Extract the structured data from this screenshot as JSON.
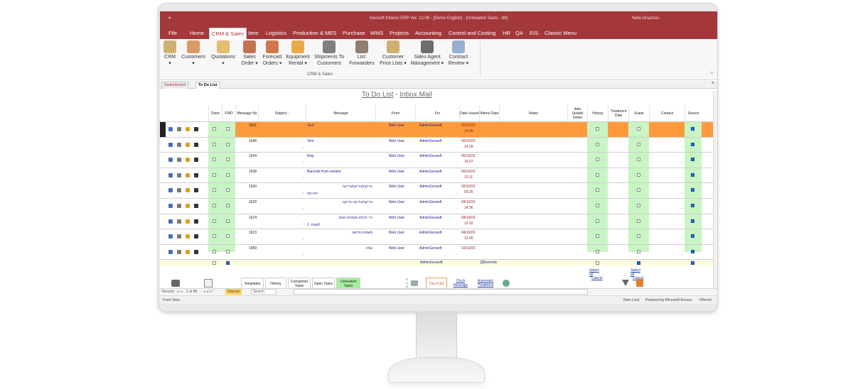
{
  "window": {
    "qat": "▾",
    "title": "Geosoft Kitaron ERP Ver. 12.06 - [Demo English] - [Untreated Tasks - 89]",
    "user": "Neta Griaznov"
  },
  "tabs": [
    "File",
    "Home",
    "CRM & Sales",
    "Item",
    "Logistics",
    "Production & MES",
    "Purchase",
    "WMS",
    "Projects",
    "Accounting",
    "Control and Costing",
    "HR",
    "QA",
    "EIS",
    "Classic Menu"
  ],
  "ribbon": {
    "buttons": [
      {
        "label1": "CRM",
        "label2": "▾",
        "color": "#c9a35a"
      },
      {
        "label1": "Customers",
        "label2": "▾",
        "color": "#d38b4a"
      },
      {
        "label1": "Quotations",
        "label2": "▾",
        "color": "#e0b25a"
      },
      {
        "label1": "Sales",
        "label2": "Order ▾",
        "color": "#b85a3a"
      },
      {
        "label1": "Forecast",
        "label2": "Orders ▾",
        "color": "#c8612f"
      },
      {
        "label1": "Equipment",
        "label2": "Rental ▾",
        "color": "#e89b2a"
      },
      {
        "label1": "Shipments To",
        "label2": "Customers",
        "color": "#6a6a6a"
      },
      {
        "label1": "List:",
        "label2": "Forwarders",
        "color": "#7b6a5a"
      },
      {
        "label1": "Customer",
        "label2": "Price Lists ▾",
        "color": "#c9a35a"
      },
      {
        "label1": "Sales Agent",
        "label2": "Management ▾",
        "color": "#555555"
      },
      {
        "label1": "Contract",
        "label2": "Review ▾",
        "color": "#8aa2c8"
      }
    ],
    "group_label": "CRM & Sales",
    "collapse": "^"
  },
  "doc_tabs": [
    {
      "label": "Switchboard"
    },
    {
      "label": "To Do List"
    }
  ],
  "doc_close": "×",
  "caption": {
    "part1": "To Do List",
    "sep": " - ",
    "part2": "Inbox Mail"
  },
  "columns": [
    "Done",
    "FWD",
    "Message No",
    "Subject...",
    "Message",
    "From",
    "For",
    "Date Issued",
    "Memo Date",
    "Notes",
    "date Update Notes",
    "History",
    "Treatment Date",
    "Erase",
    "Contact",
    "Source"
  ],
  "rows": [
    {
      "no": "1651",
      "message": "Test",
      "from": "Web User",
      "for": "AdminGeosoft",
      "date": "05/10/23",
      "time": "14:45",
      "selected": true,
      "source": true
    },
    {
      "no": "1648",
      "message": "Tom",
      "from": "Web User",
      "for": "AdminGeosoft",
      "date": "05/10/23",
      "time": "14:29",
      "selected": false,
      "source": true
    },
    {
      "no": "1644",
      "message": "Rog",
      "from": "Web User",
      "for": "AdminGeosoft",
      "date": "05/10/23",
      "time": "14:27",
      "selected": false,
      "source": true
    },
    {
      "no": "1638",
      "message": "Barcode from monitor",
      "from": "Web User",
      "for": "AdminGeosoft",
      "date": "05/10/23",
      "time": "12:11",
      "selected": false,
      "source": true
    },
    {
      "no": "1630",
      "message": "בדיקה/בדיקה/בדיקה",
      "message2": "חח-חח",
      "from": "Web User",
      "for": "AdminGeosoft",
      "date": "05/10/23",
      "time": "09:25",
      "selected": false,
      "source": true
    },
    {
      "no": "1628",
      "message": "בדיקה/בדיקה בדיקה",
      "from": "Web User",
      "for": "AdminGeosoft",
      "date": "04/10/23",
      "time": "14:36",
      "selected": false,
      "source": true
    },
    {
      "no": "1624",
      "message": "היי לכולם משימת הזמנ",
      "message2": "1. לשנות",
      "from": "Web User",
      "for": "AdminGeosoft",
      "date": "04/10/23",
      "time": "12:32",
      "selected": false,
      "source": true
    },
    {
      "no": "1623",
      "message": "משימה חדשה",
      "from": "Web User",
      "for": "AdminGeosoft",
      "date": "04/10/23",
      "time": "12:05",
      "selected": false,
      "source": true
    },
    {
      "no": "1589",
      "message": "שלה",
      "from": "Web User",
      "for": "AdminGeosoft",
      "date": "03/10/23",
      "time": "",
      "selected": false,
      "source": true
    }
  ],
  "filter_row": {
    "for": "AdminGeosoft",
    "memo": "[[Rememb"
  },
  "select_all": "Select all",
  "cancel": "Cancel",
  "bottom_buttons": [
    "Templates",
    "History",
    "Completed Tasks",
    "Open Tasks",
    "Untreated Tasks"
  ],
  "scan_label": "S C N",
  "doc_fold": "Doc Fold",
  "clock_message": "Clock Message",
  "automatic_treatment": "Automatic Treatment",
  "recnav": {
    "label": "Record:",
    "counter": "1 of 89",
    "filtered": "Filtered",
    "search": "Search"
  },
  "status": {
    "left": "Form View",
    "num": "Num Lock",
    "powered": "Powered by Microsoft Access",
    "filtered": "Filtered"
  }
}
